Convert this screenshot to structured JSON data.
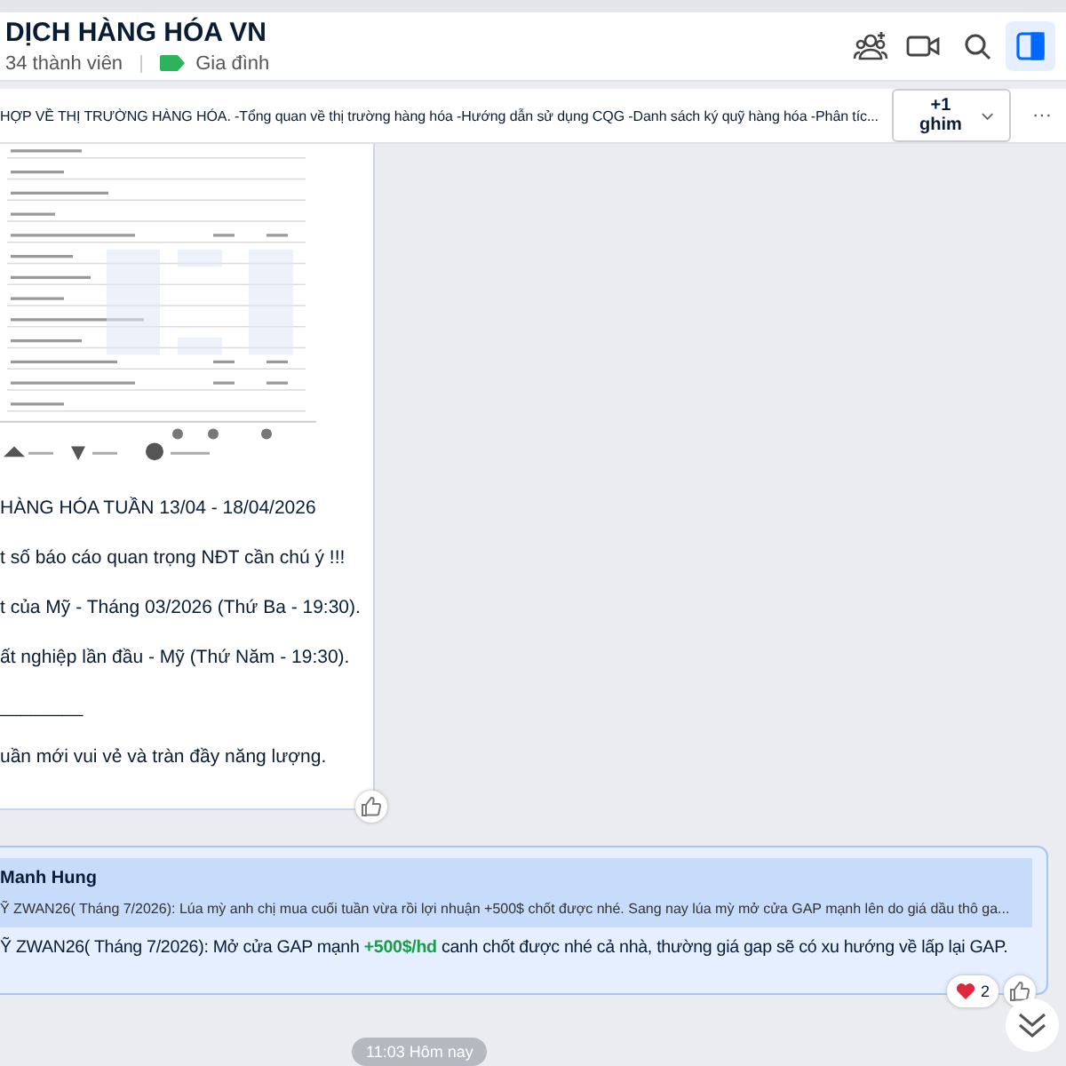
{
  "header": {
    "title": "DỊCH HÀNG HÓA VN",
    "members": "34 thành viên",
    "tag": {
      "label": "Gia đình",
      "color": "#2db45a"
    },
    "tools": [
      {
        "kind": "add-member",
        "selected": false
      },
      {
        "kind": "video",
        "selected": false
      },
      {
        "kind": "search",
        "selected": false
      },
      {
        "kind": "sidebar",
        "selected": true
      }
    ]
  },
  "pinned": {
    "text": "HỢP VỀ THỊ TRƯỜNG HÀNG HÓA. -Tổng quan về thị trường hàng hóa -Hướng dẫn sử dụng CQG -Danh sách ký quỹ hàng hóa -Phân tíc...",
    "more_button": "+1 ghim",
    "menu": "···"
  },
  "messages": [
    {
      "kind": "post",
      "lines": [
        "HÀNG HÓA TUẦN 13/04 - 18/04/2026",
        "t số báo cáo quan trọng NĐT cần chú ý !!!",
        "t của Mỹ - Tháng 03/2026 (Thứ Ba - 19:30).",
        "ất nghiệp lần đầu - Mỹ (Thứ Năm - 19:30).",
        "________",
        "uần mới vui vẻ và tràn đầy năng lượng."
      ]
    },
    {
      "kind": "reply",
      "quote_author": "Manh Hung",
      "quote_text": "Ỹ ZWAN26( Tháng 7/2026): Lúa mỳ anh chị mua cuối tuần vừa rồi lợi nhuận +500$ chốt được nhé. Sang nay lúa mỳ mở cửa GAP mạnh lên do giá dầu thô ga...",
      "body": [
        {
          "text": "Ỹ ZWAN26( Tháng 7/2026): Mở cửa GAP mạnh ",
          "highlight": false
        },
        {
          "text": "+500$/hd",
          "highlight": true
        },
        {
          "text": " canh chốt được nhé cả nhà, thường giá gap sẽ có xu hướng về lấp lại GAP.",
          "highlight": false
        }
      ],
      "heart_count": "2"
    }
  ],
  "time_divider": "11:03 Hôm nay"
}
